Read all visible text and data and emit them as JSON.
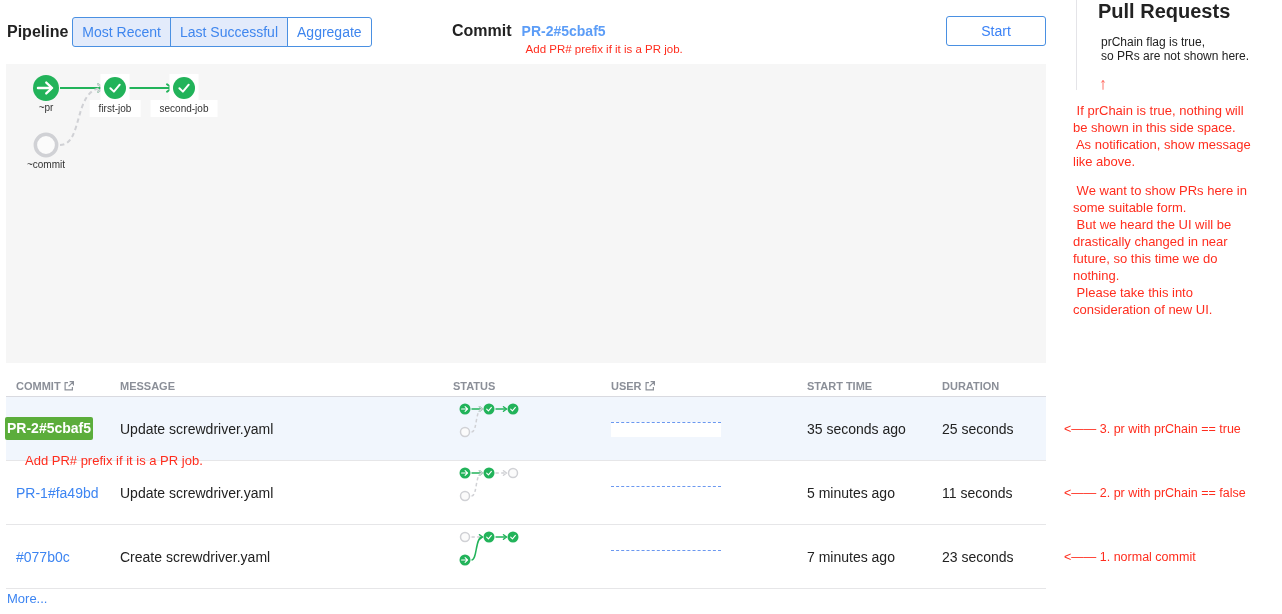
{
  "toolbar": {
    "title": "Pipeline",
    "views": [
      {
        "label": "Most Recent",
        "selected": true
      },
      {
        "label": "Last Successful",
        "selected": true
      },
      {
        "label": "Aggregate",
        "selected": false
      }
    ],
    "commit": {
      "label": "Commit",
      "value": "PR-2#5cbaf5",
      "annotation": "Add PR# prefix if it is a PR job."
    },
    "start_button": "Start"
  },
  "pipeline_graph": {
    "nodes": [
      {
        "name": "~pr",
        "kind": "trigger",
        "succeeded": true
      },
      {
        "name": "~commit",
        "kind": "trigger",
        "succeeded": false
      },
      {
        "name": "first-job",
        "kind": "job",
        "succeeded": true
      },
      {
        "name": "second-job",
        "kind": "job",
        "succeeded": true
      }
    ]
  },
  "pull_requests": {
    "title": "Pull Requests",
    "notice": "prChain flag is true,\nso PRs are not shown here.",
    "annotations": [
      " If prChain is true, nothing will\nbe shown in this side space.\n As notification, show message\nlike above.",
      " We want to show PRs here in\nsome suitable form.\n But we heard the UI will be\ndrastically changed in near\nfuture, so this time we do\nnothing.\n Please take this into\nconsideration of new UI."
    ]
  },
  "table": {
    "columns": [
      {
        "label": "COMMIT",
        "external_link": true
      },
      {
        "label": "MESSAGE",
        "external_link": false
      },
      {
        "label": "STATUS",
        "external_link": false
      },
      {
        "label": "USER",
        "external_link": true
      },
      {
        "label": "START TIME",
        "external_link": false
      },
      {
        "label": "DURATION",
        "external_link": false
      }
    ],
    "rows": [
      {
        "selected": true,
        "commit": {
          "kind": "badge",
          "text": "PR-2#5cbaf5"
        },
        "annotation": "Add PR# prefix if it is a PR job.",
        "message": "Update screwdriver.yaml",
        "status_graph": [
          {
            "succeeded": true
          },
          {
            "succeeded": false
          },
          {
            "succeeded": true
          },
          {
            "succeeded": true
          }
        ],
        "user_redacted": true,
        "start_time": "35 seconds ago",
        "duration": "25 seconds",
        "side_note": "<—— 3. pr with prChain == true"
      },
      {
        "selected": false,
        "commit": {
          "kind": "link",
          "text": "PR-1#fa49bd"
        },
        "message": "Update screwdriver.yaml",
        "status_graph": [
          {
            "succeeded": true
          },
          {
            "succeeded": false
          },
          {
            "succeeded": true
          },
          {
            "succeeded": false
          }
        ],
        "user_redacted": true,
        "start_time": "5 minutes ago",
        "duration": "11 seconds",
        "side_note": "<—— 2. pr with prChain == false"
      },
      {
        "selected": false,
        "commit": {
          "kind": "link",
          "text": "#077b0c"
        },
        "message": "Create screwdriver.yaml",
        "status_graph": [
          {
            "succeeded": false
          },
          {
            "succeeded": true
          },
          {
            "succeeded": true
          },
          {
            "succeeded": true
          }
        ],
        "user_redacted": true,
        "start_time": "7 minutes ago",
        "duration": "23 seconds",
        "side_note": "<—— 1. normal commit"
      }
    ],
    "more_link": "More..."
  }
}
